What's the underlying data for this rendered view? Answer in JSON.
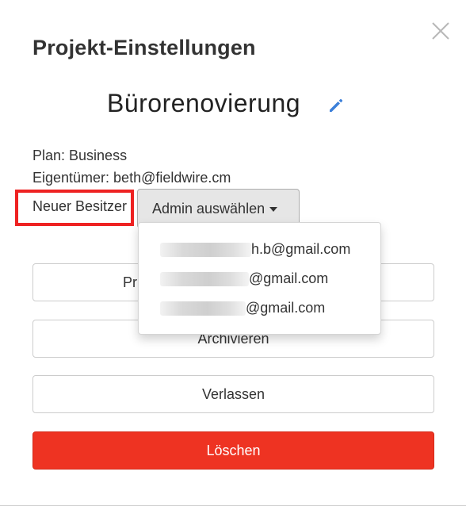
{
  "modal": {
    "title": "Projekt-Einstellungen",
    "project_name": "Bürorenovierung",
    "plan_line": "Plan: Business",
    "owner_line": "Eigentümer: beth@fieldwire.cm",
    "new_owner_label": "Neuer Besitzer",
    "admin_select_label": "Admin auswählen",
    "admin_options": [
      {
        "visible_email": "h.b@gmail.com"
      },
      {
        "visible_email": "@gmail.com"
      },
      {
        "visible_email": "@gmail.com"
      }
    ],
    "buttons": {
      "first_partial": "Pr",
      "archive": "Archivieren",
      "leave": "Verlassen",
      "delete": "Löschen"
    }
  },
  "colors": {
    "delete_red": "#ee3322",
    "highlight_red": "#ee2222",
    "edit_blue": "#3b7fd9",
    "select_gray": "#e6e6e6"
  },
  "icons": {
    "close": "close-icon",
    "edit": "pencil-icon",
    "caret": "caret-down-icon"
  }
}
